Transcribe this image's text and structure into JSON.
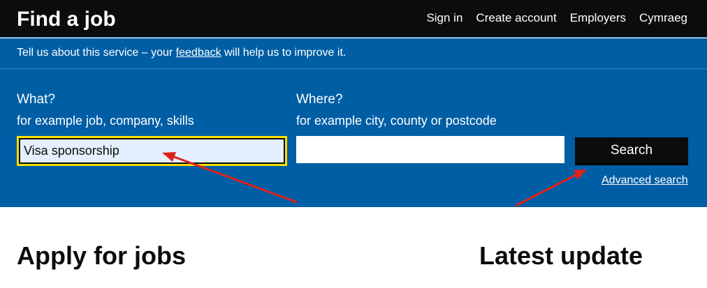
{
  "header": {
    "brand": "Find a job",
    "nav": [
      "Sign in",
      "Create account",
      "Employers",
      "Cymraeg"
    ]
  },
  "banner": {
    "text_before": "Tell us about this service – your ",
    "link": "feedback",
    "text_after": " will help us to improve it."
  },
  "search": {
    "what_label": "What?",
    "what_hint": "for example job, company, skills",
    "what_value": "Visa sponsorship",
    "where_label": "Where?",
    "where_hint": "for example city, county or postcode",
    "where_value": "",
    "button": "Search",
    "advanced_link": "Advanced search"
  },
  "sections": {
    "apply_heading": "Apply for jobs",
    "latest_heading": "Latest update"
  },
  "colors": {
    "header_bg": "#0b0c0c",
    "panel_blue": "#005ea5",
    "focus_yellow": "#ffdd00",
    "annotation_red": "#e0221b"
  }
}
